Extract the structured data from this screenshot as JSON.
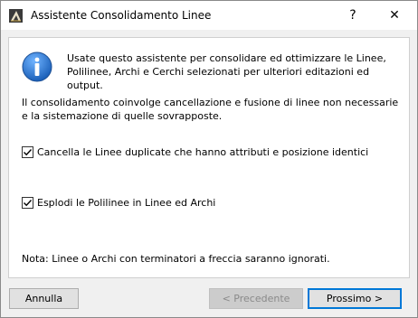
{
  "window": {
    "title": "Assistente Consolidamento Linee",
    "help_glyph": "?",
    "close_glyph": "✕",
    "app_icon": "archicad-app-icon"
  },
  "content": {
    "info_icon": "info-icon",
    "intro_text": "Usate questo assistente per consolidare ed ottimizzare le Linee, Polilinee, Archi e Cerchi selezionati per ulteriori editazioni ed output.",
    "description": "Il consolidamento coinvolge cancellazione e fusione di linee non necessarie e la sistemazione di quelle sovrapposte.",
    "options": [
      {
        "label": "Cancella le Linee duplicate che hanno attributi e posizione identici",
        "checked": true
      },
      {
        "label": "Esplodi le Polilinee in Linee ed Archi",
        "checked": true
      }
    ],
    "note": "Nota: Linee o Archi con terminatori a freccia saranno ignorati."
  },
  "buttons": {
    "cancel": "Annulla",
    "previous": "< Precedente",
    "previous_enabled": false,
    "next": "Prossimo >"
  },
  "colors": {
    "accent": "#0078d7",
    "info_blue": "#1e6fc8"
  }
}
